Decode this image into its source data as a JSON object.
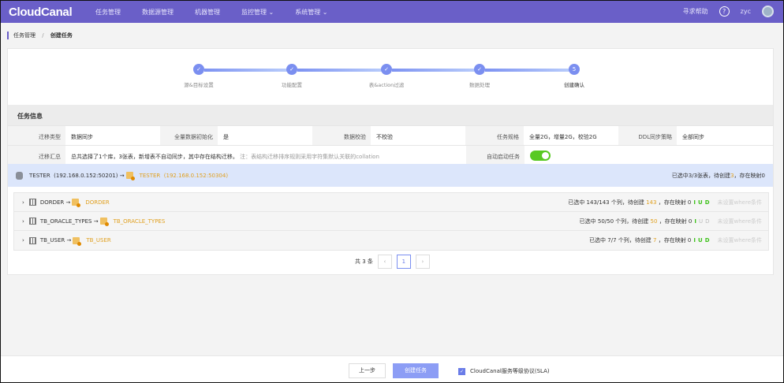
{
  "nav": {
    "logo": "CloudCanal",
    "items": [
      "任务管理",
      "数据源管理",
      "机器管理",
      "监控管理 ⌄",
      "系统管理 ⌄"
    ],
    "help": "寻求帮助",
    "help_icon": "?",
    "user": "zyc"
  },
  "breadcrumb": {
    "parent": "任务管理",
    "sep": "/",
    "current": "创建任务"
  },
  "steps": [
    {
      "label": "源&目标设置",
      "mark": "✓"
    },
    {
      "label": "功能配置",
      "mark": "✓"
    },
    {
      "label": "表&action过滤",
      "mark": "✓"
    },
    {
      "label": "数据处理",
      "mark": "✓"
    },
    {
      "label": "创建确认",
      "mark": "5"
    }
  ],
  "section_title": "任务信息",
  "info": {
    "migrate_type_label": "迁移类型",
    "migrate_type": "数据同步",
    "full_init_label": "全量数据初始化",
    "full_init": "是",
    "verify_label": "数据校验",
    "verify": "不校验",
    "spec_label": "任务规格",
    "spec": "全量2G，增量2G，校验2G",
    "ddl_label": "DDL同步策略",
    "ddl": "全部同步",
    "summary_label": "迁移汇总",
    "summary": "总共选择了1个库，3张表，新增表不自动同步，其中存在结构迁移。",
    "summary_note": "注：表结构迁移排序规则采用字符集默认关联的collation",
    "auto_start_label": "自动启动任务",
    "auto_start": true
  },
  "source": {
    "src_name": "TESTER",
    "src_addr": "(192.168.0.152:50201)",
    "arrow": "→",
    "dst_name": "TESTER",
    "dst_addr": "(192.168.0.152:50304)",
    "stat_prefix": "已选中3/3张表，待创建",
    "stat_count": "3",
    "stat_suffix": "，存在映射0"
  },
  "tables": [
    {
      "src": "DORDER",
      "dst": "DORDER",
      "prefix": "已选中 143/143 个列，待创建",
      "count": "143",
      "suffix": "，存在映射 0",
      "i": "I",
      "u": "U",
      "d": "D",
      "ud_active": true,
      "where": "未设置where条件"
    },
    {
      "src": "TB_ORACLE_TYPES",
      "dst": "TB_ORACLE_TYPES",
      "prefix": "已选中 50/50 个列，待创建",
      "count": "50",
      "suffix": "，存在映射 0",
      "i": "I",
      "u": "U",
      "d": "D",
      "ud_active": false,
      "where": "未设置where条件"
    },
    {
      "src": "TB_USER",
      "dst": "TB_USER",
      "prefix": "已选中 7/7 个列，待创建",
      "count": "7",
      "suffix": "，存在映射 0",
      "i": "I",
      "u": "U",
      "d": "D",
      "ud_active": true,
      "where": "未设置where条件"
    }
  ],
  "pagination": {
    "total": "共 3 条",
    "prev": "‹",
    "page": "1",
    "next": "›"
  },
  "footer": {
    "prev": "上一步",
    "create": "创建任务",
    "sla": "CloudCanal服务等级协议(SLA)",
    "sla_checked": true
  }
}
